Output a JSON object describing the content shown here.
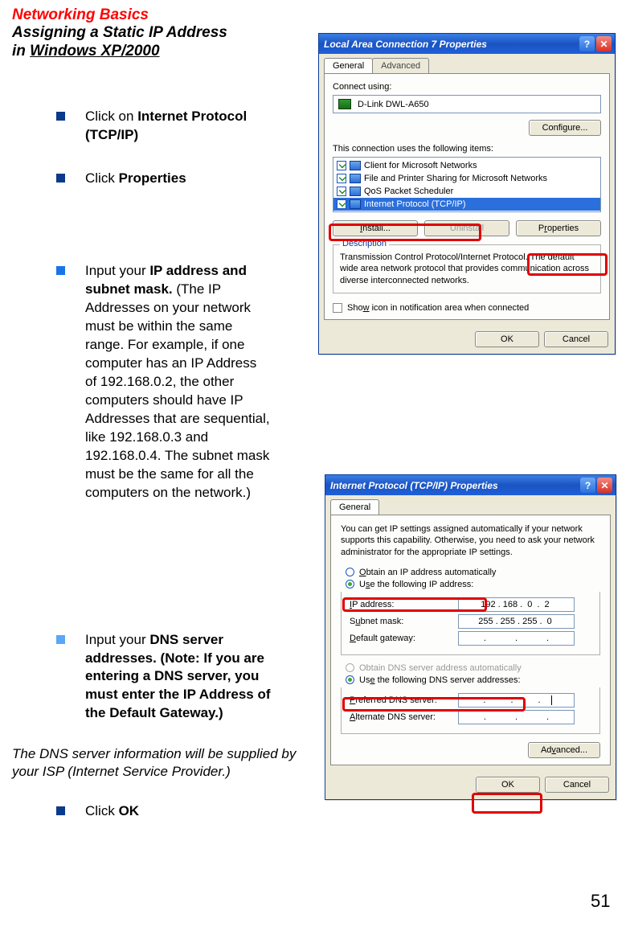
{
  "heading": {
    "red": "Networking Basics",
    "line1": "Assigning a Static IP Address",
    "line2_pre": "in ",
    "line2_ul": "Windows XP/2000"
  },
  "bullets": {
    "b1_pre": "Click on ",
    "b1_bold": "Internet Protocol (TCP/IP)",
    "b2_pre": "Click ",
    "b2_bold": "Properties",
    "b3_pre": "Input your ",
    "b3_bold": "IP address and subnet mask.",
    "b3_rest": " (The IP Addresses on your network must be within the same range. For example, if one computer has an IP Address of 192.168.0.2, the other computers should have IP Addresses that are sequential, like 192.168.0.3 and 192.168.0.4. The subnet mask must be the same for all the computers on the network.)",
    "b4_pre": "Input your ",
    "b4_bold": "DNS server addresses. (Note:  If you are entering a DNS server, you must enter the IP Address of the Default Gateway.)",
    "b5_pre": "Click ",
    "b5_bold": "OK"
  },
  "note": "The DNS server information will be supplied by your ISP (Internet Service Provider.)",
  "pagenum": "51",
  "win1": {
    "title": "Local Area Connection 7 Properties",
    "tab_general": "General",
    "tab_advanced": "Advanced",
    "connect_using": "Connect using:",
    "adapter": "D-Link DWL-A650",
    "configure": "Configure...",
    "uses_items": "This connection uses the following items:",
    "items": [
      "Client for Microsoft Networks",
      "File and Printer Sharing for Microsoft Networks",
      "QoS Packet Scheduler",
      "Internet Protocol (TCP/IP)"
    ],
    "install": "Install...",
    "uninstall": "Uninstall",
    "properties": "Properties",
    "desc_title": "Description",
    "desc_text": "Transmission Control Protocol/Internet Protocol. The default wide area network protocol that provides communication across diverse interconnected networks.",
    "show_icon": "Show icon in notification area when connected",
    "ok": "OK",
    "cancel": "Cancel"
  },
  "win2": {
    "title": "Internet Protocol (TCP/IP) Properties",
    "tab_general": "General",
    "intro": "You can get IP settings assigned automatically if your network supports this capability. Otherwise, you need to ask your network administrator for the appropriate IP settings.",
    "radio_auto_ip": "Obtain an IP address automatically",
    "radio_use_ip": "Use the following IP address:",
    "ip_label": "IP address:",
    "subnet_label": "Subnet mask:",
    "gateway_label": "Default gateway:",
    "radio_auto_dns": "Obtain DNS server address automatically",
    "radio_use_dns": "Use the following DNS server addresses:",
    "pref_dns": "Preferred DNS server:",
    "alt_dns": "Alternate DNS server:",
    "ip_value": [
      "192",
      "168",
      "0",
      "2"
    ],
    "subnet_value": [
      "255",
      "255",
      "255",
      "0"
    ],
    "advanced": "Advanced...",
    "ok": "OK",
    "cancel": "Cancel"
  }
}
